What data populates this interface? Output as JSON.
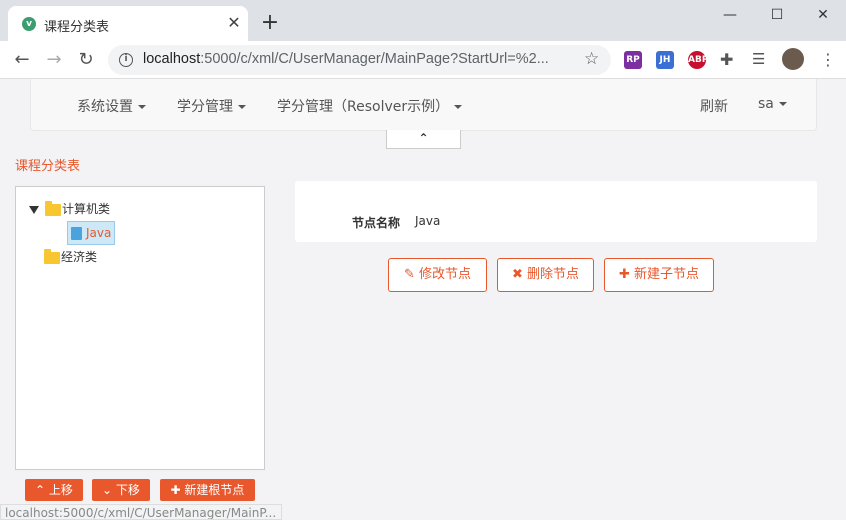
{
  "browser": {
    "tab_title": "课程分类表",
    "tab_favicon": "v",
    "url_host": "localhost",
    "url_rest": ":5000/c/xml/C/UserManager/MainPage?StartUrl=%2...",
    "status_url": "localhost:5000/c/xml/C/UserManager/MainP..."
  },
  "nav": {
    "menus": [
      "系统设置",
      "学分管理",
      "学分管理（Resolver示例）"
    ],
    "refresh": "刷新",
    "user": "sa"
  },
  "page": {
    "title": "课程分类表",
    "collapse_icon": "chevron-up-icon"
  },
  "tree": {
    "nodes": [
      {
        "label": "计算机类",
        "expanded": true,
        "icon": "folder-icon"
      },
      {
        "label": "Java",
        "selected": true,
        "icon": "file-icon"
      },
      {
        "label": "经济类",
        "icon": "folder-icon"
      }
    ]
  },
  "tree_buttons": {
    "up": "上移",
    "down": "下移",
    "new_root": "新建根节点"
  },
  "form": {
    "node_name_label": "节点名称",
    "node_name_value": "Java"
  },
  "actions": {
    "edit": "修改节点",
    "delete": "删除节点",
    "new_child": "新建子节点"
  },
  "colors": {
    "accent": "#e9582c"
  }
}
